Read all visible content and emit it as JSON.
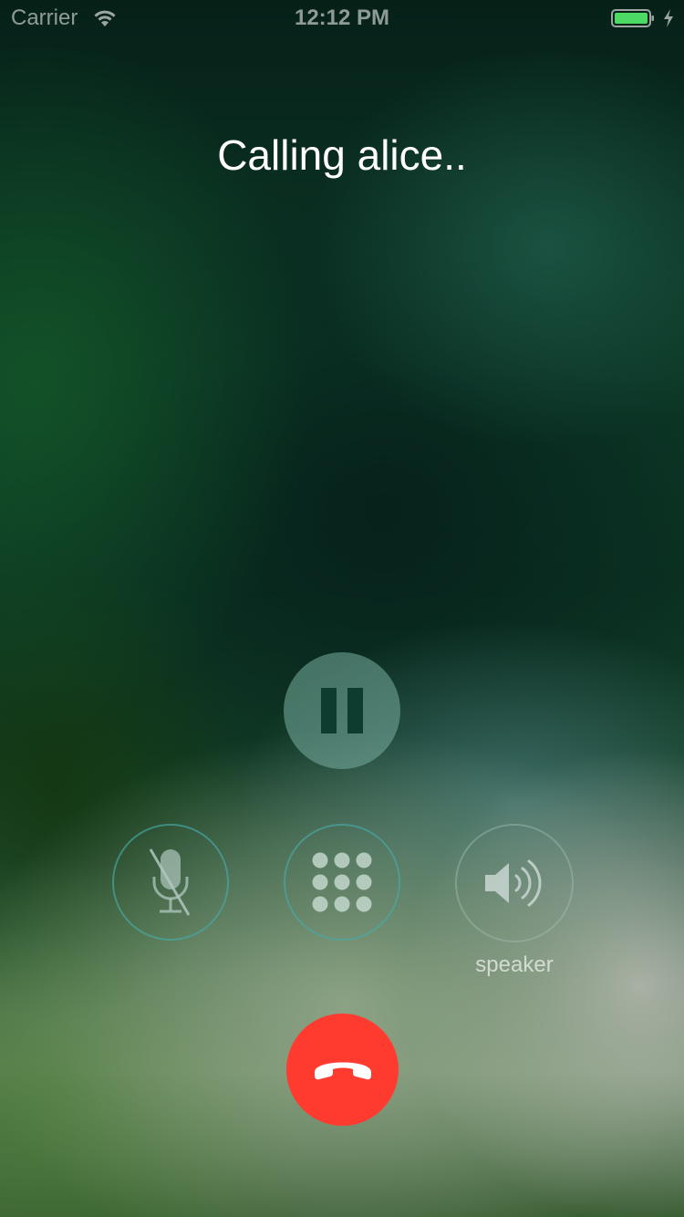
{
  "status_bar": {
    "carrier": "Carrier",
    "time": "12:12 PM",
    "battery_color": "#4cd964"
  },
  "call": {
    "status_text": "Calling alice.."
  },
  "controls": {
    "hold_icon": "pause-icon",
    "mute_icon": "microphone-slash-icon",
    "keypad_icon": "keypad-icon",
    "speaker_icon": "speaker-icon",
    "speaker_label": "speaker",
    "end_call_icon": "phone-hangup-icon",
    "end_call_color": "#ff3b30"
  }
}
